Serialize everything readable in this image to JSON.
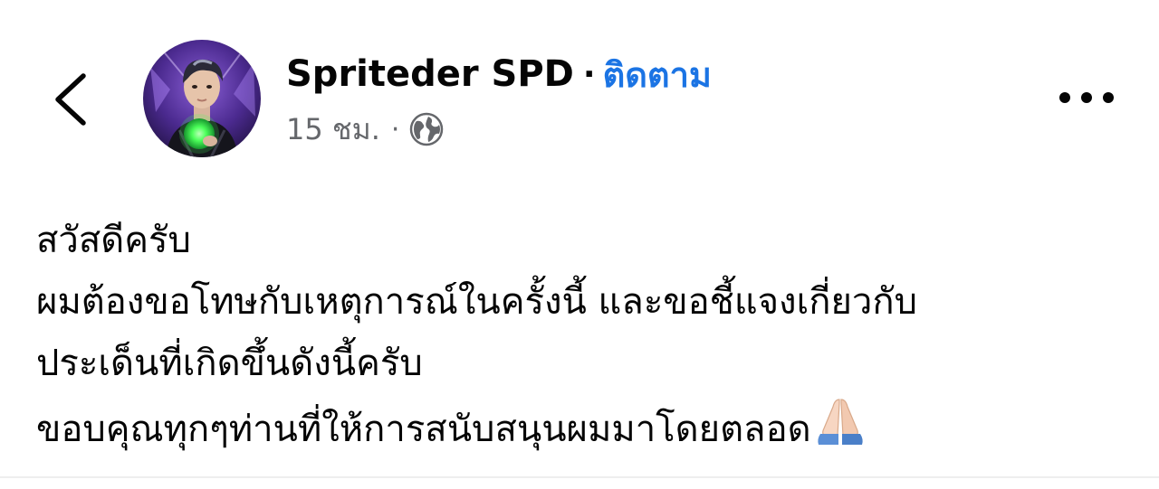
{
  "header": {
    "back_icon": "chevron-left-icon",
    "author_name": "Spriteder SPD",
    "separator": "·",
    "follow_label": "ติดตาม",
    "timestamp": "15 ชม.",
    "meta_separator": "·",
    "privacy_icon": "globe-icon",
    "more_icon": "more-horizontal-icon"
  },
  "post": {
    "lines": [
      "สวัสดีครับ",
      "ผมต้องขอโทษกับเหตุการณ์ในครั้งนี้ และขอชี้แจงเกี่ยวกับ",
      "ประเด็นที่เกิดขึ้นดังนี้ครับ",
      "ขอบคุณทุกๆท่านที่ให้การสนับสนุนผมมาโดยตลอด"
    ],
    "trailing_emoji": "folded-hands-emoji"
  },
  "colors": {
    "follow_link": "#1b74e4",
    "meta_text": "#65676b",
    "body_text": "#050505"
  }
}
